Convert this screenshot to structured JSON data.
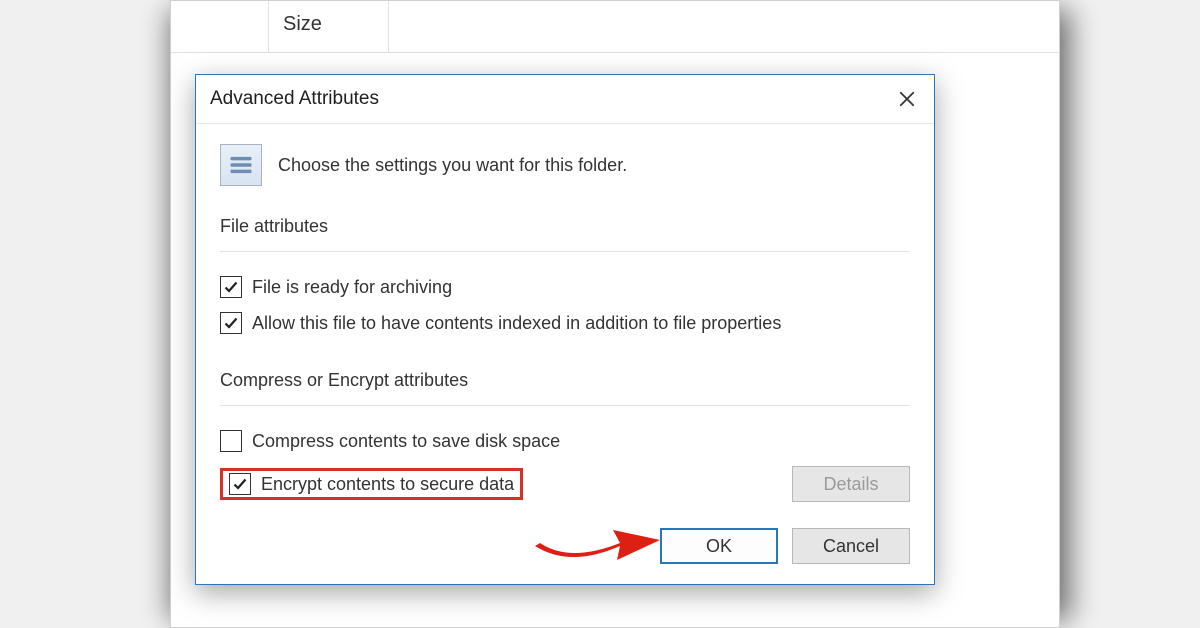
{
  "parent": {
    "column_header": "Size"
  },
  "dialog": {
    "title": "Advanced Attributes",
    "intro": "Choose the settings you want for this folder.",
    "file_attributes_label": "File attributes",
    "archiving_label": "File is ready for archiving",
    "archiving_checked": true,
    "indexed_label": "Allow this file to have contents indexed in addition to file properties",
    "indexed_checked": true,
    "compress_encrypt_label": "Compress or Encrypt attributes",
    "compress_label": "Compress contents to save disk space",
    "compress_checked": false,
    "encrypt_label": "Encrypt contents to secure data",
    "encrypt_checked": true,
    "details_label": "Details",
    "ok_label": "OK",
    "cancel_label": "Cancel"
  }
}
